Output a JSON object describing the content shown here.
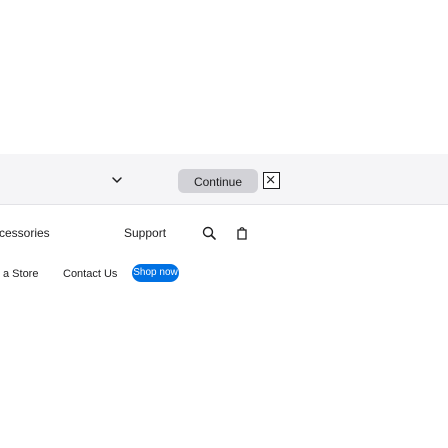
{
  "region_bar": {
    "continue_label": "Continue",
    "icons": {
      "chevron": "chevron-down-icon",
      "close": "close-icon"
    },
    "colors": {
      "bar_background": "#f5f5f7",
      "button_background": "#d2d2d7",
      "text": "#1d1d1f"
    }
  },
  "nav": {
    "accessories_label": "cessories",
    "support_label": "Support",
    "icons": {
      "search": "search-icon",
      "bag": "bag-icon"
    }
  },
  "footer_links": {
    "store_label": "a Store",
    "contact_label": "Contact Us",
    "shop_now_label": "Shop now",
    "shop_now_color": "#0071e3"
  }
}
